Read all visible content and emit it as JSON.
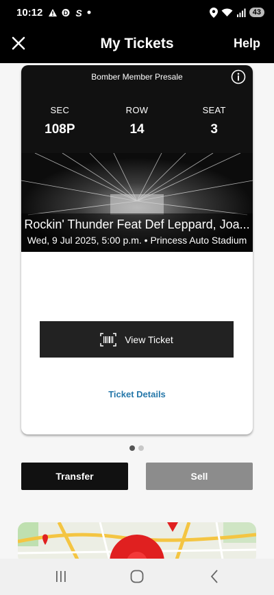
{
  "status_bar": {
    "time": "10:12",
    "battery": "43"
  },
  "header": {
    "title": "My Tickets",
    "help_label": "Help"
  },
  "ticket": {
    "presale_label": "Bomber Member Presale",
    "seat_labels": {
      "sec": "SEC",
      "row": "ROW",
      "seat": "SEAT"
    },
    "seat_values": {
      "sec": "108P",
      "row": "14",
      "seat": "3"
    },
    "event_name": "Rockin' Thunder Feat Def Leppard, Joa...",
    "event_meta": "Wed, 9 Jul 2025, 5:00 p.m. • Princess Auto Stadium",
    "view_ticket_label": "View Ticket",
    "ticket_details_label": "Ticket Details"
  },
  "pager": {
    "total": 2,
    "current": 1
  },
  "actions": {
    "transfer_label": "Transfer",
    "sell_label": "Sell"
  }
}
